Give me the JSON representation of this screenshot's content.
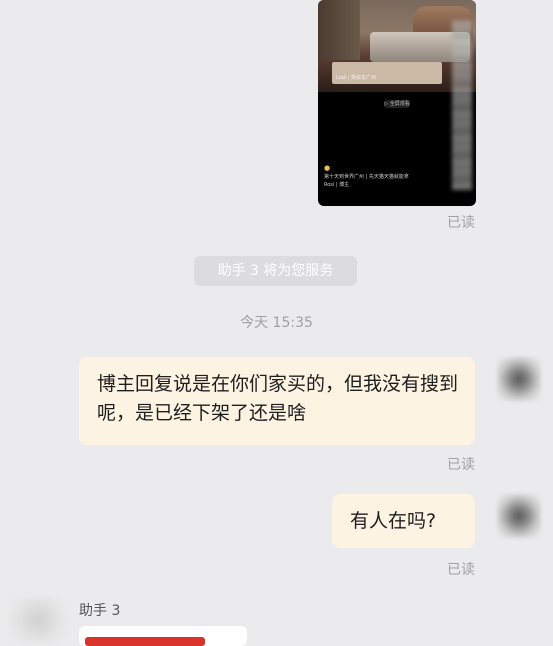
{
  "shared_image": {
    "photo_caption": "Lodi | 购买东广州",
    "play_label": "▷ 全屏观看",
    "bottom_text": "第十天到世界广州 | 先天猫天猫就能拿",
    "bottom_meta": "Rosi | 博主"
  },
  "messages": {
    "read_label_1": "已读",
    "system_notice": "助手 3 将为您服务",
    "timestamp": "今天 15:35",
    "user_msg_1": "博主回复说是在你们家买的，但我没有搜到呢，是已经下架了还是啥",
    "read_label_2": "已读",
    "user_msg_2": "有人在吗?",
    "read_label_3": "已读",
    "agent_name": "助手 3"
  },
  "colors": {
    "background": "#ebebed",
    "user_bubble": "#fdf3e2",
    "system_pill": "#dcdcde",
    "muted_text": "#a0a0a0",
    "accent_red": "#d9342b"
  }
}
